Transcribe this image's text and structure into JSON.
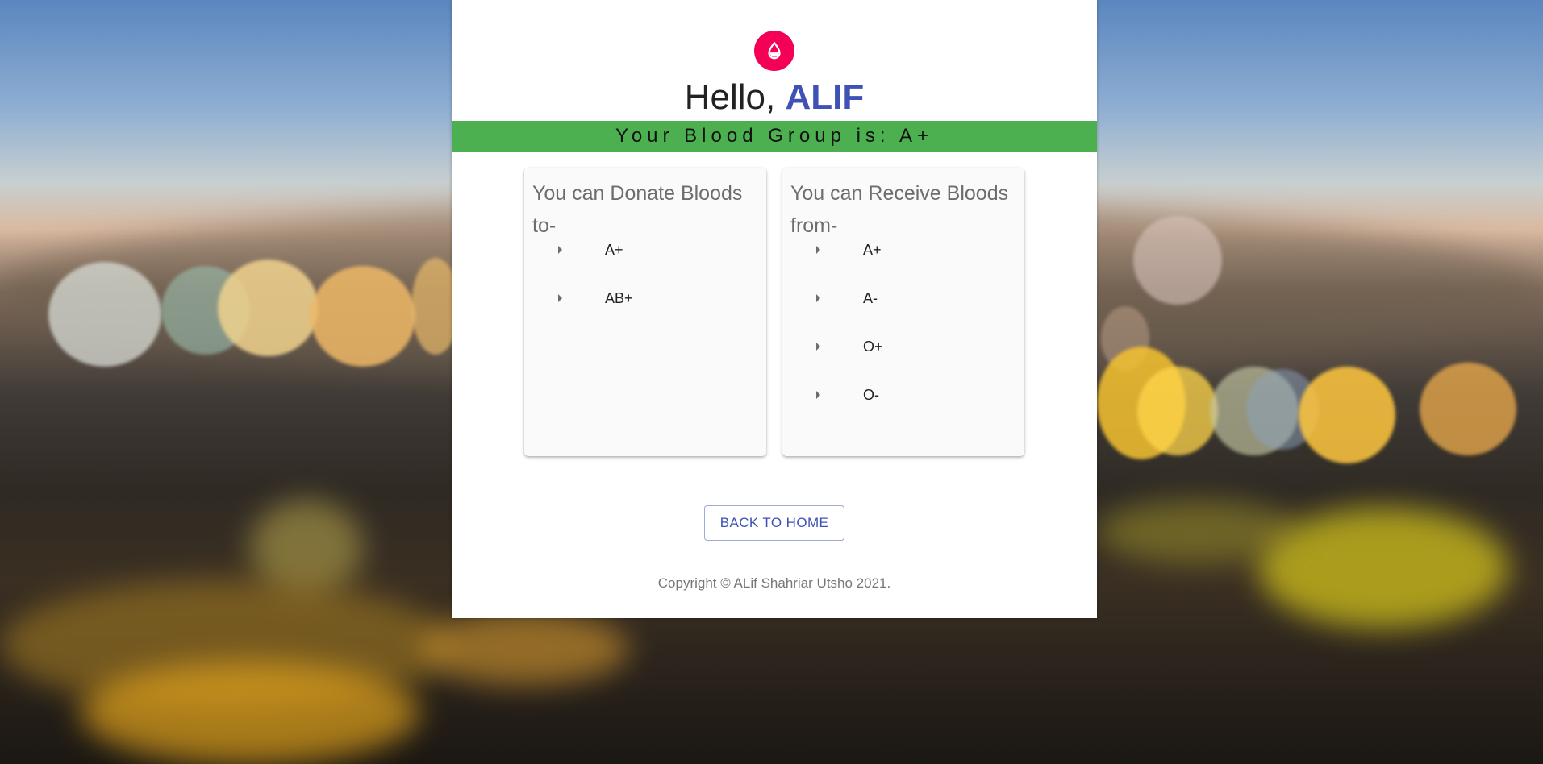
{
  "header": {
    "greeting_prefix": "Hello, ",
    "user_name": "ALIF",
    "logo_icon": "blood-drop-icon"
  },
  "banner": {
    "text": "Your Blood Group is: A+"
  },
  "donate": {
    "title": "You can Donate Bloods to-",
    "items": [
      "A+",
      "AB+"
    ]
  },
  "receive": {
    "title": "You can Receive Bloods from-",
    "items": [
      "A+",
      "A-",
      "O+",
      "O-"
    ]
  },
  "actions": {
    "back_label": "BACK TO HOME"
  },
  "footer": {
    "copyright": "Copyright © ALif Shahriar Utsho 2021."
  },
  "colors": {
    "accent": "#3f51b5",
    "logo": "#f50057",
    "banner": "#4caf50"
  }
}
